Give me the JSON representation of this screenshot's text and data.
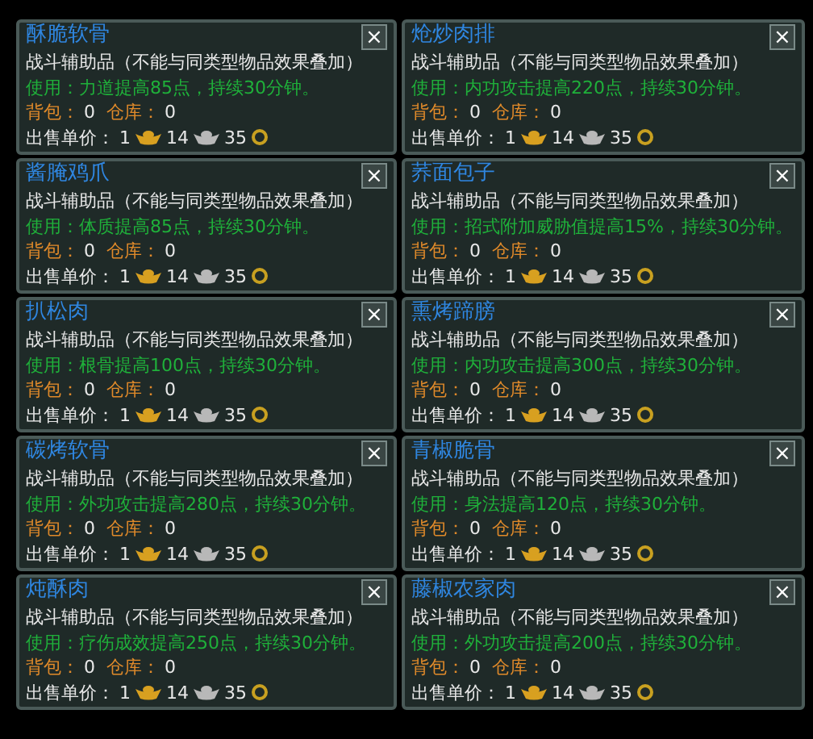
{
  "items": [
    {
      "name": "酥脆软骨",
      "close": "×",
      "category": "战斗辅助品（不能与同类型物品效果叠加）",
      "effect": "使用：力道提高85点，持续30分钟。",
      "bag_label": "背包：",
      "bag_value": "0",
      "warehouse_label": "仓库：",
      "warehouse_value": "0",
      "price_label": "出售单价：",
      "gold": "1",
      "silver": "14",
      "copper": "35"
    },
    {
      "name": "炝炒肉排",
      "close": "×",
      "category": "战斗辅助品（不能与同类型物品效果叠加）",
      "effect": "使用：内功攻击提高220点，持续30分钟。",
      "bag_label": "背包：",
      "bag_value": "0",
      "warehouse_label": "仓库：",
      "warehouse_value": "0",
      "price_label": "出售单价：",
      "gold": "1",
      "silver": "14",
      "copper": "35"
    },
    {
      "name": "酱腌鸡爪",
      "close": "×",
      "category": "战斗辅助品（不能与同类型物品效果叠加）",
      "effect": "使用：体质提高85点，持续30分钟。",
      "bag_label": "背包：",
      "bag_value": "0",
      "warehouse_label": "仓库：",
      "warehouse_value": "0",
      "price_label": "出售单价：",
      "gold": "1",
      "silver": "14",
      "copper": "35"
    },
    {
      "name": "荞面包子",
      "close": "×",
      "category": "战斗辅助品（不能与同类型物品效果叠加）",
      "effect": "使用：招式附加威胁值提高15%，持续30分钟。",
      "bag_label": "背包：",
      "bag_value": "0",
      "warehouse_label": "仓库：",
      "warehouse_value": "0",
      "price_label": "出售单价：",
      "gold": "1",
      "silver": "14",
      "copper": "35"
    },
    {
      "name": "扒松肉",
      "close": "×",
      "category": "战斗辅助品（不能与同类型物品效果叠加）",
      "effect": "使用：根骨提高100点，持续30分钟。",
      "bag_label": "背包：",
      "bag_value": "0",
      "warehouse_label": "仓库：",
      "warehouse_value": "0",
      "price_label": "出售单价：",
      "gold": "1",
      "silver": "14",
      "copper": "35"
    },
    {
      "name": "熏烤蹄膀",
      "close": "×",
      "category": "战斗辅助品（不能与同类型物品效果叠加）",
      "effect": "使用：内功攻击提高300点，持续30分钟。",
      "bag_label": "背包：",
      "bag_value": "0",
      "warehouse_label": "仓库：",
      "warehouse_value": "0",
      "price_label": "出售单价：",
      "gold": "1",
      "silver": "14",
      "copper": "35"
    },
    {
      "name": "碳烤软骨",
      "close": "×",
      "category": "战斗辅助品（不能与同类型物品效果叠加）",
      "effect": "使用：外功攻击提高280点，持续30分钟。",
      "bag_label": "背包：",
      "bag_value": "0",
      "warehouse_label": "仓库：",
      "warehouse_value": "0",
      "price_label": "出售单价：",
      "gold": "1",
      "silver": "14",
      "copper": "35"
    },
    {
      "name": "青椒脆骨",
      "close": "×",
      "category": "战斗辅助品（不能与同类型物品效果叠加）",
      "effect": "使用：身法提高120点，持续30分钟。",
      "bag_label": "背包：",
      "bag_value": "0",
      "warehouse_label": "仓库：",
      "warehouse_value": "0",
      "price_label": "出售单价：",
      "gold": "1",
      "silver": "14",
      "copper": "35"
    },
    {
      "name": "炖酥肉",
      "close": "×",
      "category": "战斗辅助品（不能与同类型物品效果叠加）",
      "effect": "使用：疗伤成效提高250点，持续30分钟。",
      "bag_label": "背包：",
      "bag_value": "0",
      "warehouse_label": "仓库：",
      "warehouse_value": "0",
      "price_label": "出售单价：",
      "gold": "1",
      "silver": "14",
      "copper": "35"
    },
    {
      "name": "藤椒农家肉",
      "close": "×",
      "category": "战斗辅助品（不能与同类型物品效果叠加）",
      "effect": "使用：外功攻击提高200点，持续30分钟。",
      "bag_label": "背包：",
      "bag_value": "0",
      "warehouse_label": "仓库：",
      "warehouse_value": "0",
      "price_label": "出售单价：",
      "gold": "1",
      "silver": "14",
      "copper": "35"
    }
  ]
}
